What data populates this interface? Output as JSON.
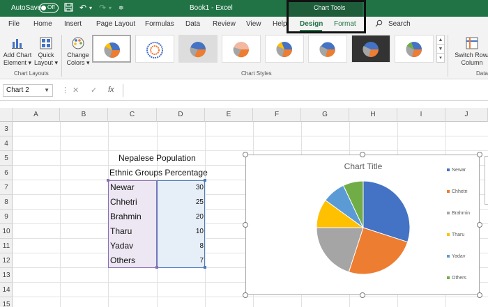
{
  "titlebar": {
    "autosave_label": "AutoSave",
    "toggle_state": "Off",
    "document": "Book1  -  Excel",
    "context_tools": "Chart Tools"
  },
  "menu": {
    "items": [
      "File",
      "Home",
      "Insert",
      "Page Layout",
      "Formulas",
      "Data",
      "Review",
      "View",
      "Help"
    ],
    "context_tabs": [
      "Design",
      "Format"
    ],
    "active": "Design",
    "search": "Search"
  },
  "ribbon": {
    "add_chart_element": [
      "Add Chart",
      "Element ▾"
    ],
    "quick_layout": [
      "Quick",
      "Layout ▾"
    ],
    "change_colors": [
      "Change",
      "Colors ▾"
    ],
    "switch_row_column": [
      "Switch Row/",
      "Column"
    ],
    "groups": {
      "chart_layouts": "Chart Layouts",
      "chart_styles": "Chart Styles",
      "data": "Data"
    }
  },
  "formula_bar": {
    "name_box": "Chart 2",
    "fx": "fx",
    "cancel": "✕",
    "enter": "✓",
    "value": ""
  },
  "sheet": {
    "columns": [
      "A",
      "B",
      "C",
      "D",
      "E",
      "F",
      "G",
      "H",
      "I",
      "J"
    ],
    "rows": [
      "3",
      "4",
      "5",
      "6",
      "7",
      "8",
      "9",
      "10",
      "11",
      "12",
      "13",
      "14",
      "15"
    ],
    "heading": "Nepalese Population",
    "subheading": "Ethnic Groups Percentage",
    "table": [
      {
        "group": "Newar",
        "value": "30"
      },
      {
        "group": "Chhetri",
        "value": "25"
      },
      {
        "group": "Brahmin",
        "value": "20"
      },
      {
        "group": "Tharu",
        "value": "10"
      },
      {
        "group": "Yadav",
        "value": "8"
      },
      {
        "group": "Others",
        "value": "7"
      }
    ]
  },
  "chart": {
    "title": "Chart Title"
  },
  "chart_data": {
    "type": "pie",
    "title": "Chart Title",
    "categories": [
      "Newar",
      "Chhetri",
      "Brahmin",
      "Tharu",
      "Yadav",
      "Others"
    ],
    "values": [
      30,
      25,
      20,
      10,
      8,
      7
    ],
    "colors": [
      "#4472C4",
      "#ED7D31",
      "#A5A5A5",
      "#FFC000",
      "#5B9BD5",
      "#70AD47"
    ],
    "legend": "right"
  },
  "colors": {
    "excel_green": "#217346",
    "context_green": "#1e5c3a"
  }
}
